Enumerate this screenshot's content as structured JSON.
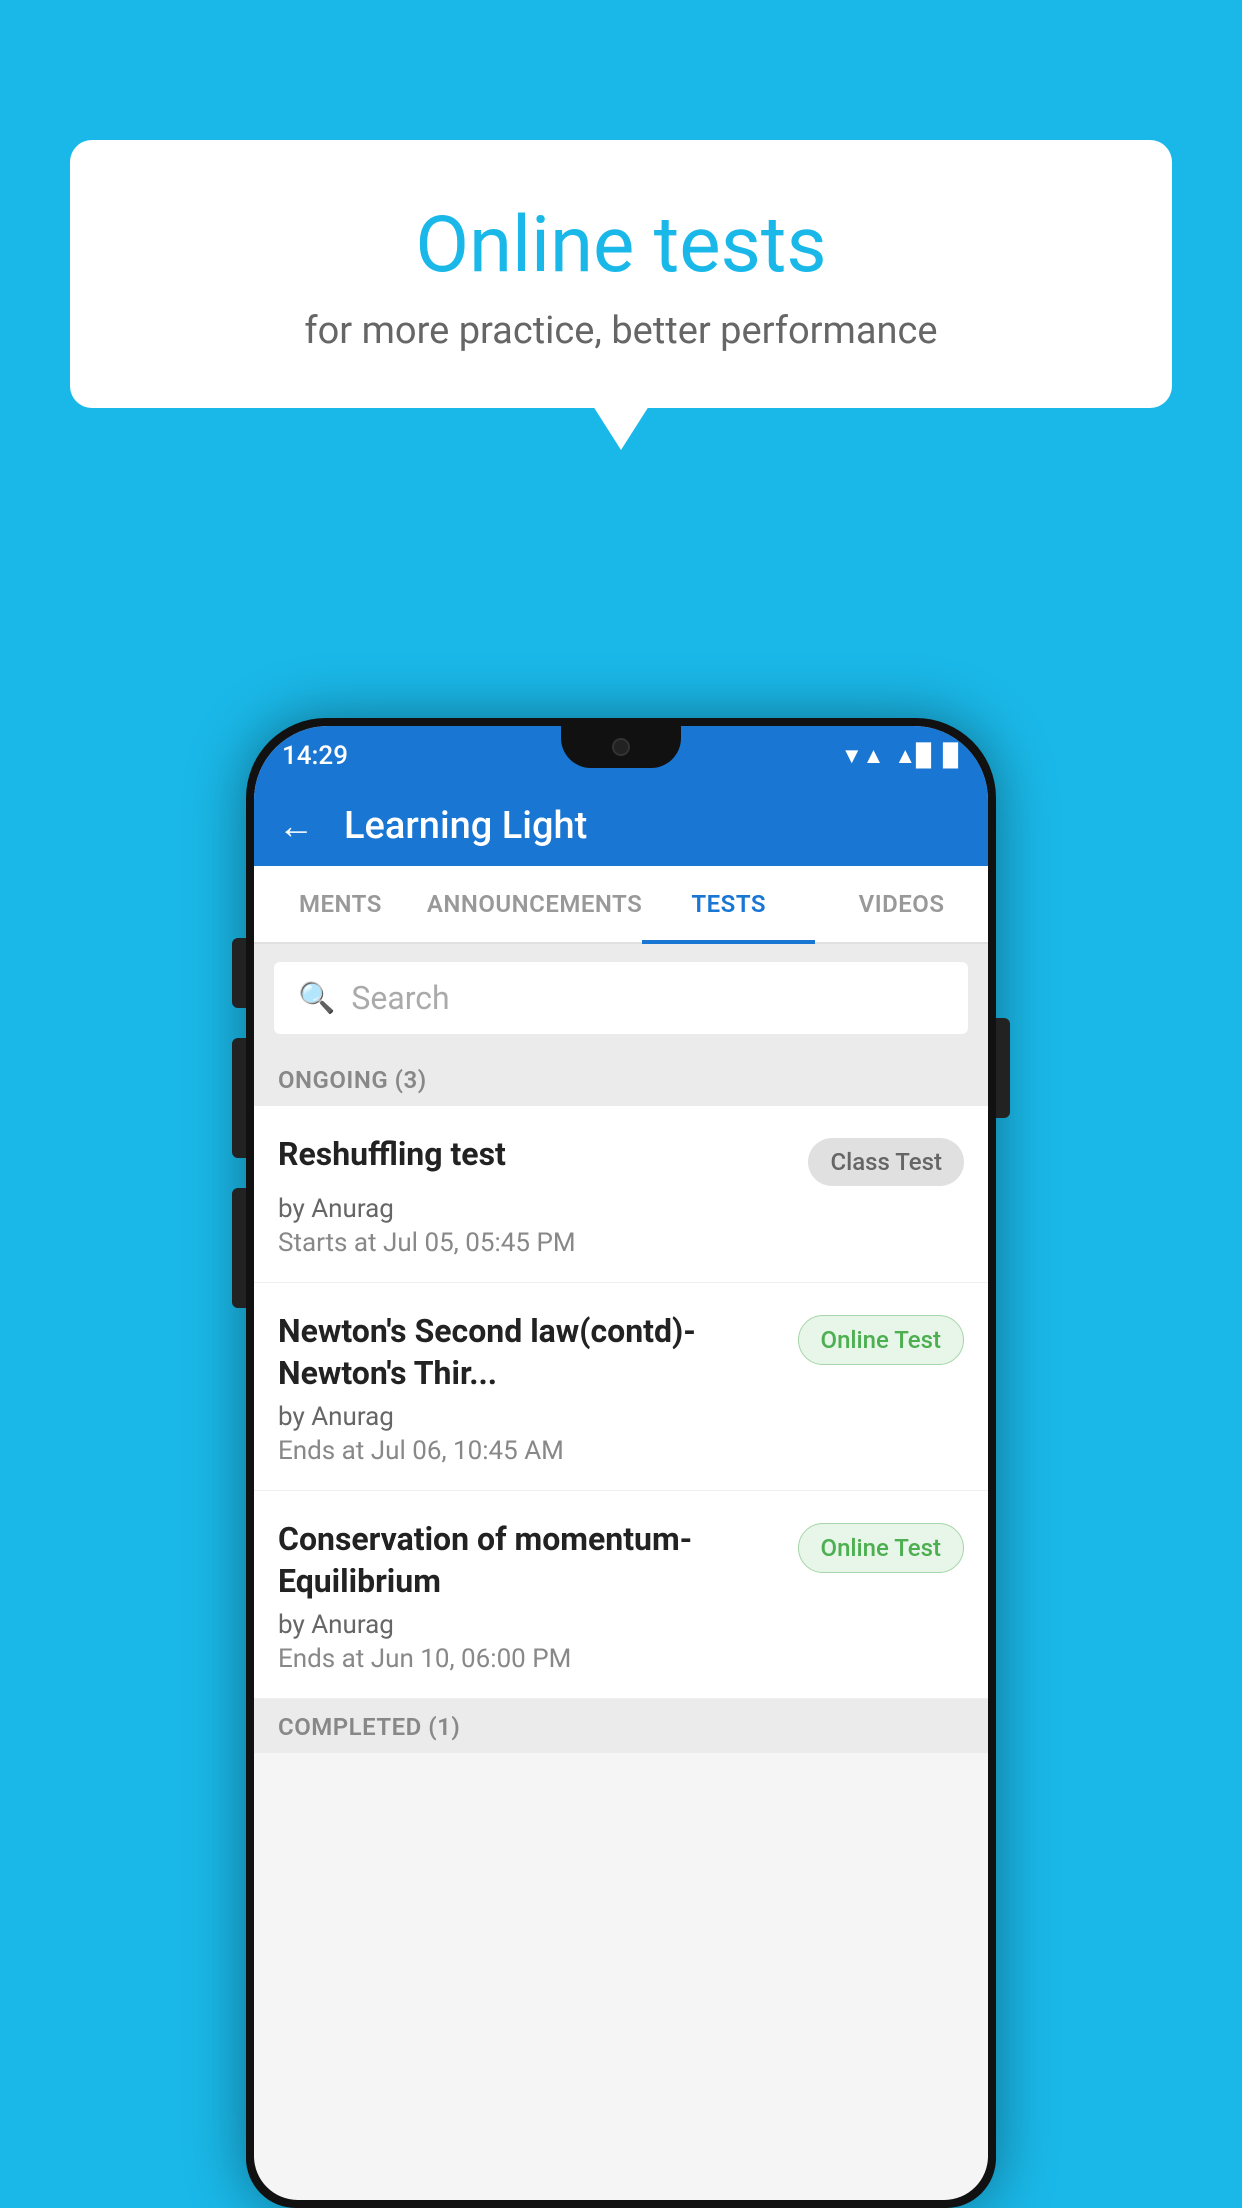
{
  "background": {
    "color": "#1ab8e8"
  },
  "speech_bubble": {
    "title": "Online tests",
    "subtitle": "for more practice, better performance"
  },
  "phone": {
    "status_bar": {
      "time": "14:29",
      "signal_icon": "▼",
      "wifi_icon": "▲",
      "battery_icon": "▉"
    },
    "app_bar": {
      "back_icon": "←",
      "title": "Learning Light"
    },
    "tabs": [
      {
        "label": "MENTS",
        "active": false
      },
      {
        "label": "ANNOUNCEMENTS",
        "active": false
      },
      {
        "label": "TESTS",
        "active": true
      },
      {
        "label": "VIDEOS",
        "active": false
      }
    ],
    "search": {
      "placeholder": "Search",
      "icon": "🔍"
    },
    "sections": [
      {
        "header": "ONGOING (3)",
        "items": [
          {
            "title": "Reshuffling test",
            "badge": "Class Test",
            "badge_type": "class",
            "author": "by Anurag",
            "date": "Starts at  Jul 05, 05:45 PM"
          },
          {
            "title": "Newton's Second law(contd)-Newton's Thir...",
            "badge": "Online Test",
            "badge_type": "online",
            "author": "by Anurag",
            "date": "Ends at  Jul 06, 10:45 AM"
          },
          {
            "title": "Conservation of momentum-Equilibrium",
            "badge": "Online Test",
            "badge_type": "online",
            "author": "by Anurag",
            "date": "Ends at  Jun 10, 06:00 PM"
          }
        ]
      }
    ],
    "completed_header": "COMPLETED (1)"
  }
}
